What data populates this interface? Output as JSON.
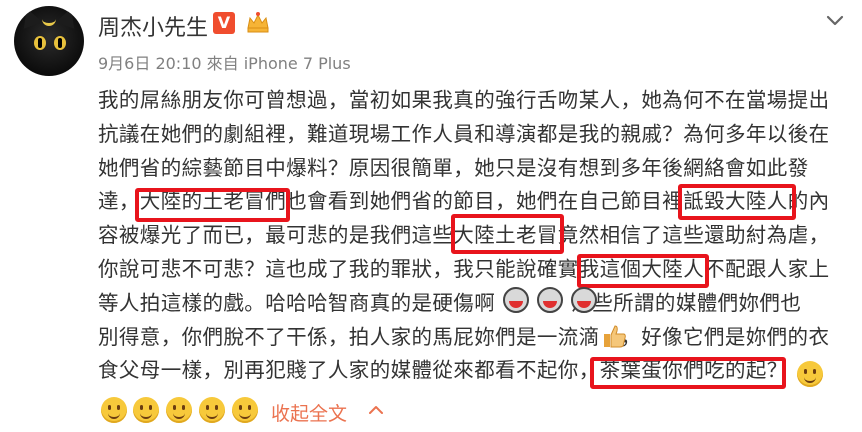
{
  "post": {
    "author": "周杰小先生",
    "vip_badge": "V",
    "meta": "9月6日 20:10 來自 iPhone 7 Plus",
    "lines": [
      "我的屌絲朋友你可曾想過，當初如果我真的強行舌吻某人，她為何不在當場提出",
      "抗議在她們的劇組裡，難道現場工作人員和導演都是我的親戚？為何多年以後在",
      "她們省的綜藝節目中爆料？原因很簡單，她只是沒有想到多年後網絡會如此發",
      "達，大陸的土老冒們也會看到她們省的節目，她們在自己節目裡詆毀大陸人的內",
      "容被爆光了而已，最可悲的是我們這些大陸土老冒竟然相信了這些還助紂為虐，",
      "你說可悲不可悲？這也成了我的罪狀，我只能說確實我這個大陸人不配跟人家上",
      "等人拍這樣的戲。哈哈哈智商真的是硬傷啊        ，那些所謂的媒體們妳們也",
      "別得意，你們脫不了干係，拍人家的馬屁妳們是一流滴   ，好像它們是妳們的衣",
      "食父母一樣，別再犯賤了人家的媒體從來都看不起你，茶葉蛋你們吃的起？"
    ],
    "highlights": [
      "大陸的土老冒們",
      "詆毀大陸人",
      "大陸土老冒",
      "我這個大陸人",
      "茶葉蛋你們吃的起？"
    ],
    "collapse_label": "收起全文"
  },
  "icons": {
    "more": "chevron-down-icon",
    "collapse": "chevron-up-icon",
    "crown": "crown-icon",
    "avatar": "black-cat-avatar"
  },
  "colors": {
    "highlight_border": "#e8141c",
    "vip_badge": "#f04d2e",
    "link": "#eb7350",
    "meta": "#808080",
    "text": "#333333"
  }
}
